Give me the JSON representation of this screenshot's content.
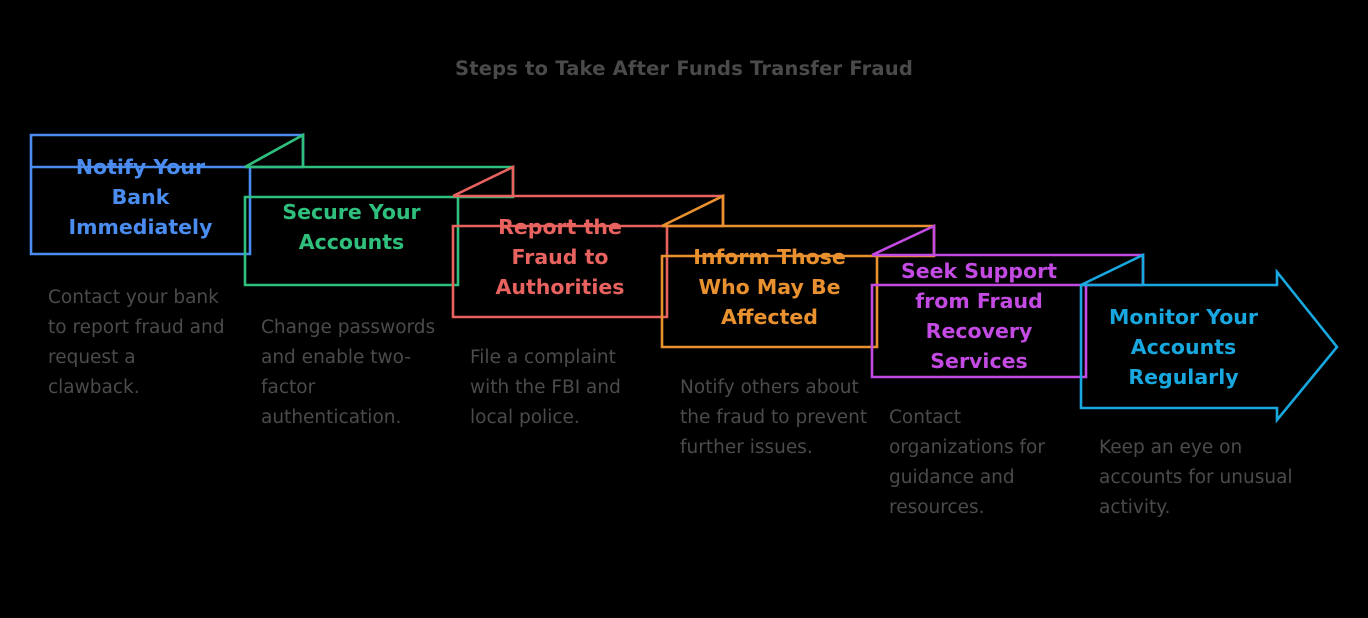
{
  "title": "Steps to Take After Funds Transfer Fraud",
  "title_color": "#4a4a4a",
  "background_color": "#000000",
  "body_text_color": "#4b4b4b",
  "chart_data": {
    "type": "diagram",
    "diagram_style": "stepped-chevron-process-flow",
    "title": "Steps to Take After Funds Transfer Fraud",
    "step_count": 6,
    "categories": [
      "Notify Your Bank Immediately",
      "Secure Your Accounts",
      "Report the Fraud to Authorities",
      "Inform Those Who May Be Affected",
      "Seek Support from Fraud Recovery Services",
      "Monitor Your Accounts Regularly"
    ],
    "descriptions": [
      "Contact your bank to report fraud and request a clawback.",
      "Change passwords and enable two-factor authentication.",
      "File a complaint with the FBI and local police.",
      "Notify others about the fraud to prevent further issues.",
      "Contact organizations for guidance and resources.",
      "Keep an eye on accounts for unusual activity."
    ],
    "colors": [
      "#4a8cf0",
      "#2fc07e",
      "#e8625f",
      "#e8912e",
      "#c34ae2",
      "#18a7de"
    ]
  },
  "steps": [
    {
      "index": "1",
      "heading": "Notify Your\nBank\nImmediately",
      "body": "Contact your\nbank to report\nfraud and\nrequest a\nclawback.",
      "color": "#4a8cf0",
      "shape": "folded-box"
    },
    {
      "index": "2",
      "heading": "Secure Your\nAccounts",
      "body": "Change\npasswords and\nenable two-\nfactor\nauthentication.",
      "color": "#2fc07e",
      "shape": "folded-box"
    },
    {
      "index": "3",
      "heading": "Report the\nFraud to\nAuthorities",
      "body": "File a\ncomplaint with\nthe FBI and\nlocal police.",
      "color": "#e8625f",
      "shape": "folded-box"
    },
    {
      "index": "4",
      "heading": "Inform Those\nWho May Be\nAffected",
      "body": "Notify others\nabout the fraud\nto prevent\nfurther issues.",
      "color": "#e8912e",
      "shape": "folded-box"
    },
    {
      "index": "5",
      "heading": "Seek Support\nfrom Fraud\nRecovery\nServices",
      "body": "Contact\norganizations\nfor guidance\nand resources.",
      "color": "#c34ae2",
      "shape": "folded-box"
    },
    {
      "index": "6",
      "heading": "Monitor Your\nAccounts\nRegularly",
      "body": "Keep an eye on\naccounts for\nunusual\nactivity.",
      "color": "#18a7de",
      "shape": "arrow"
    }
  ]
}
